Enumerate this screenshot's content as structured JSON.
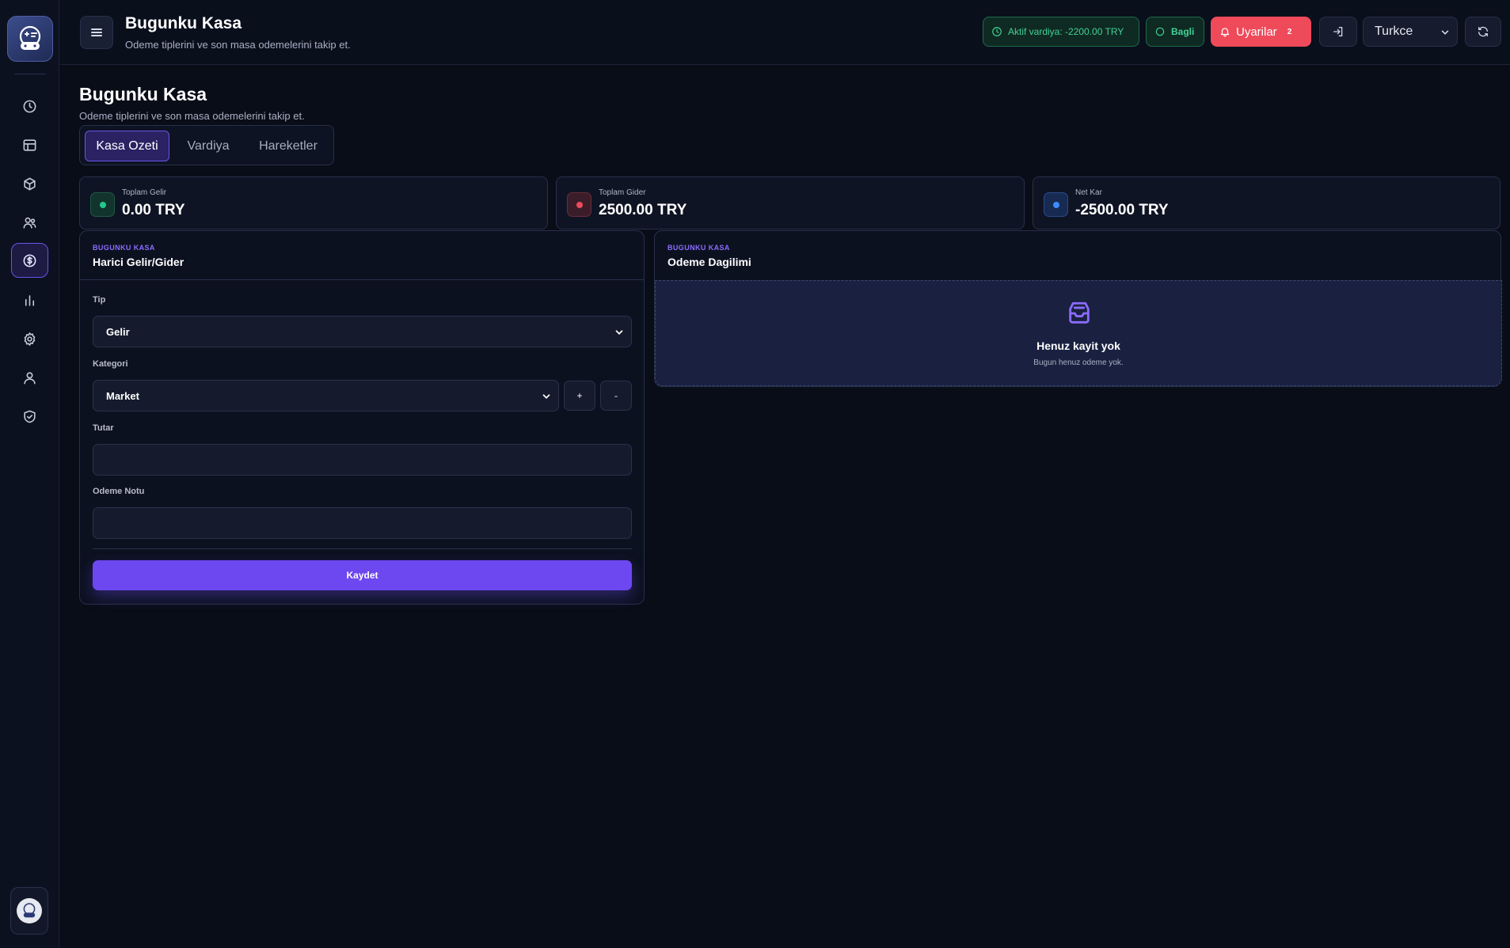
{
  "header": {
    "title": "Bugunku Kasa",
    "subtitle": "Odeme tiplerini ve son masa odemelerini takip et.",
    "shift_status": "Aktif vardiya: -2200.00 TRY",
    "connection_status": "Bagli",
    "alerts_label": "Uyarilar",
    "alerts_count": "2",
    "language": "Turkce"
  },
  "page": {
    "title": "Bugunku Kasa",
    "subtitle": "Odeme tiplerini ve son masa odemelerini takip et."
  },
  "tabs": [
    {
      "label": "Kasa Ozeti",
      "active": true
    },
    {
      "label": "Vardiya",
      "active": false
    },
    {
      "label": "Hareketler",
      "active": false
    }
  ],
  "stats": [
    {
      "label": "Toplam Gelir",
      "value": "0.00 TRY",
      "color": "#22c98a"
    },
    {
      "label": "Toplam Gider",
      "value": "2500.00 TRY",
      "color": "#ef4a5a"
    },
    {
      "label": "Net Kar",
      "value": "-2500.00 TRY",
      "color": "#3d8cff"
    }
  ],
  "form_panel": {
    "eyebrow": "BUGUNKU KASA",
    "title": "Harici Gelir/Gider",
    "type_label": "Tip",
    "type_value": "Gelir",
    "category_label": "Kategori",
    "category_value": "Market",
    "add_label": "+",
    "remove_label": "-",
    "amount_label": "Tutar",
    "amount_value": "",
    "note_label": "Odeme Notu",
    "note_value": "",
    "save_label": "Kaydet"
  },
  "distribution_panel": {
    "eyebrow": "BUGUNKU KASA",
    "title": "Odeme Dagilimi",
    "empty_title": "Henuz kayit yok",
    "empty_sub": "Bugun henuz odeme yok."
  },
  "sidebar": {
    "items": [
      {
        "icon": "clock-icon"
      },
      {
        "icon": "table-icon"
      },
      {
        "icon": "box-icon"
      },
      {
        "icon": "users-icon"
      },
      {
        "icon": "dollar-icon",
        "active": true
      },
      {
        "icon": "bar-chart-icon"
      },
      {
        "icon": "gear-icon"
      },
      {
        "icon": "user-icon"
      },
      {
        "icon": "shield-check-icon"
      }
    ]
  },
  "colors": {
    "accent": "#6d47f0",
    "success": "#43d196",
    "danger": "#ef4a5a",
    "background": "#090d18"
  }
}
